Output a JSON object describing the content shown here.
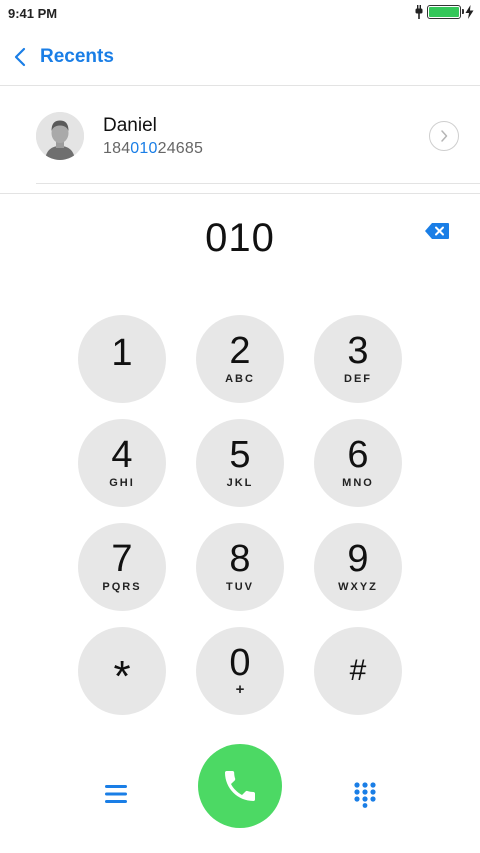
{
  "status": {
    "time": "9:41 PM",
    "battery_level": 1.0,
    "battery_color": "#34c759"
  },
  "nav": {
    "back_label": "Recents",
    "accent_color": "#1a7ee6"
  },
  "contact": {
    "name": "Daniel",
    "number_prefix": "184",
    "number_match": "010",
    "number_suffix": "24685"
  },
  "dialer": {
    "entered": "010"
  },
  "keys": [
    {
      "digit": "1",
      "letters": ""
    },
    {
      "digit": "2",
      "letters": "ABC"
    },
    {
      "digit": "3",
      "letters": "DEF"
    },
    {
      "digit": "4",
      "letters": "GHI"
    },
    {
      "digit": "5",
      "letters": "JKL"
    },
    {
      "digit": "6",
      "letters": "MNO"
    },
    {
      "digit": "7",
      "letters": "PQRS"
    },
    {
      "digit": "8",
      "letters": "TUV"
    },
    {
      "digit": "9",
      "letters": "WXYZ"
    },
    {
      "digit": "*",
      "letters": ""
    },
    {
      "digit": "0",
      "letters": "+"
    },
    {
      "digit": "#",
      "letters": ""
    }
  ],
  "icons": {
    "back": "chevron-left-icon",
    "detail": "chevron-right-icon",
    "delete": "backspace-icon",
    "menu": "menu-icon",
    "call": "phone-icon",
    "keypad": "keypad-icon"
  },
  "colors": {
    "call_button": "#4cd964",
    "key_background": "#e7e7e7"
  }
}
